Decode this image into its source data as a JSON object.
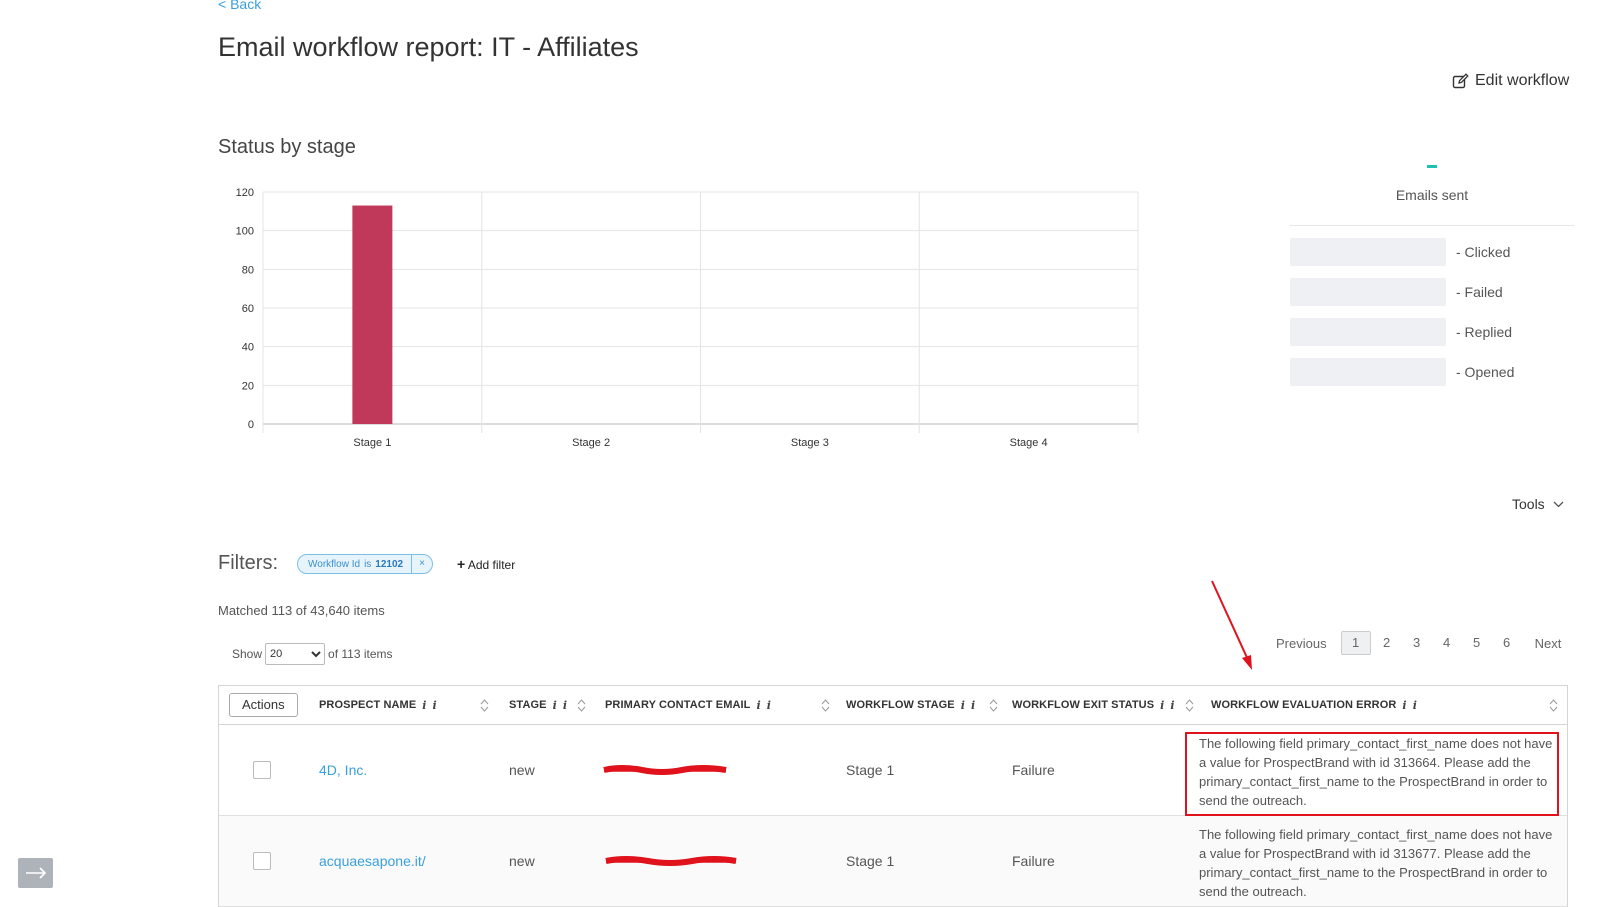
{
  "back_link": "< Back",
  "page_title": "Email workflow report: IT - Affiliates",
  "edit_workflow_label": "Edit workflow",
  "status_section_title": "Status by stage",
  "chart_data": {
    "type": "bar",
    "categories": [
      "Stage 1",
      "Stage 2",
      "Stage 3",
      "Stage 4"
    ],
    "values": [
      113,
      0,
      0,
      0
    ],
    "ylim": [
      0,
      120
    ],
    "yticks": [
      0,
      20,
      40,
      60,
      80,
      100,
      120
    ],
    "grid": true,
    "bar_color": "#c0395a"
  },
  "stats": {
    "sent_label": "Emails sent",
    "rows": [
      {
        "label": "- Clicked"
      },
      {
        "label": "- Failed"
      },
      {
        "label": "- Replied"
      },
      {
        "label": "- Opened"
      }
    ]
  },
  "tools_label": "Tools",
  "filters": {
    "label": "Filters:",
    "chip_field": "Workflow Id",
    "chip_op": "is",
    "chip_value": "12102",
    "chip_close": "×",
    "add_filter_label": "Add filter"
  },
  "matched_text": "Matched 113 of 43,640 items",
  "show": {
    "label": "Show",
    "value": "20",
    "suffix": "of 113 items"
  },
  "pagination": {
    "prev": "Previous",
    "pages": [
      "1",
      "2",
      "3",
      "4",
      "5",
      "6"
    ],
    "active_page": "1",
    "next": "Next"
  },
  "table": {
    "actions_label": "Actions",
    "info_glyph": "i",
    "columns": [
      "PROSPECT NAME",
      "STAGE",
      "PRIMARY CONTACT EMAIL",
      "WORKFLOW STAGE",
      "WORKFLOW EXIT STATUS",
      "WORKFLOW EVALUATION ERROR"
    ],
    "rows": [
      {
        "prospect_name": "4D, Inc.",
        "stage": "new",
        "workflow_stage": "Stage 1",
        "exit_status": "Failure",
        "error": "The following field primary_contact_first_name does not have a value for ProspectBrand with id 313664. Please add the primary_contact_first_name to the ProspectBrand in order to send the outreach."
      },
      {
        "prospect_name": "acquaesapone.it/",
        "stage": "new",
        "workflow_stage": "Stage 1",
        "exit_status": "Failure",
        "error": "The following field primary_contact_first_name does not have a value for ProspectBrand with id 313677. Please add the primary_contact_first_name to the ProspectBrand in order to send the outreach."
      }
    ]
  },
  "colors": {
    "accent_link": "#3aa0dc",
    "highlight_box": "#e0121c",
    "sent_indicator": "#1fc2b0"
  }
}
